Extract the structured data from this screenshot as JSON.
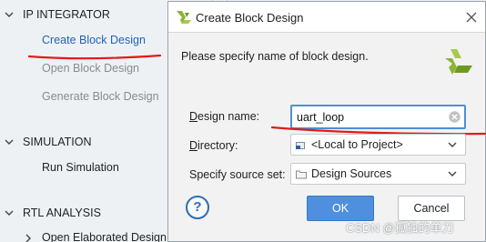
{
  "flow_navigator": {
    "ip_integrator": {
      "title": "IP INTEGRATOR",
      "items": [
        "Create Block Design",
        "Open Block Design",
        "Generate Block Design"
      ]
    },
    "simulation": {
      "title": "SIMULATION",
      "items": [
        "Run Simulation"
      ]
    },
    "rtl_analysis": {
      "title": "RTL ANALYSIS",
      "items": [
        "Open Elaborated Design"
      ]
    }
  },
  "dialog": {
    "title": "Create Block Design",
    "prompt": "Please specify name of block design.",
    "design_name": {
      "label_mnemonic": "D",
      "label_rest": "esign name:",
      "value": "uart_loop"
    },
    "directory": {
      "label_mnemonic": "D",
      "label_rest": "irectory:",
      "value": "<Local to Project>"
    },
    "source_set": {
      "label": "Specify source set:",
      "value": "Design Sources"
    },
    "buttons": {
      "help": "?",
      "ok": "OK",
      "cancel": "Cancel"
    }
  },
  "colors": {
    "link": "#1e63b4",
    "primary_button": "#4f8fdd",
    "annotation_red": "#e21b1b",
    "logo_green": "#8bb531"
  },
  "icons": [
    "chevron-down-icon",
    "chevron-right-icon",
    "vivado-logo-icon",
    "close-icon",
    "clear-icon",
    "folder-icon",
    "help-icon"
  ],
  "watermark": "CSDN @孤独的单刀"
}
